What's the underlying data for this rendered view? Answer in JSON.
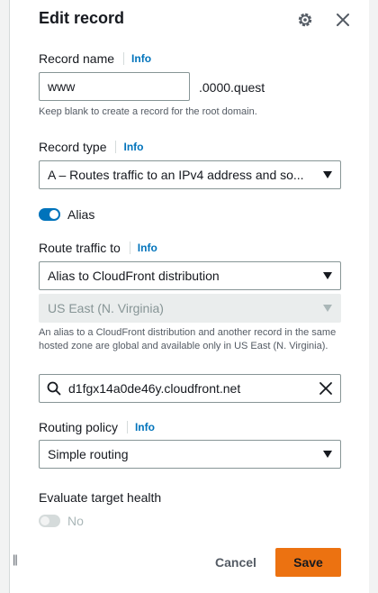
{
  "panel": {
    "title": "Edit record",
    "icons": {
      "settings": "gear-icon",
      "close": "close-icon"
    }
  },
  "record_name": {
    "label": "Record name",
    "info": "Info",
    "value": "www",
    "domain_suffix": ".0000.quest",
    "hint": "Keep blank to create a record for the root domain."
  },
  "record_type": {
    "label": "Record type",
    "info": "Info",
    "value": "A – Routes traffic to an IPv4 address and so..."
  },
  "alias": {
    "label": "Alias",
    "enabled": true
  },
  "route_traffic": {
    "label": "Route traffic to",
    "info": "Info",
    "endpoint": "Alias to CloudFront distribution",
    "region": "US East (N. Virginia)",
    "hint": "An alias to a CloudFront distribution and another record in the same hosted zone are global and available only in US East (N. Virginia).",
    "distribution": "d1fgx14a0de46y.cloudfront.net"
  },
  "routing_policy": {
    "label": "Routing policy",
    "info": "Info",
    "value": "Simple routing"
  },
  "evaluate_health": {
    "label": "Evaluate target health",
    "value_label": "No",
    "enabled": false
  },
  "footer": {
    "cancel": "Cancel",
    "save": "Save"
  },
  "resize_handle": "||",
  "colors": {
    "accent": "#0073bb",
    "primary_button": "#ec7211",
    "text": "#16191f",
    "muted": "#545b64"
  }
}
